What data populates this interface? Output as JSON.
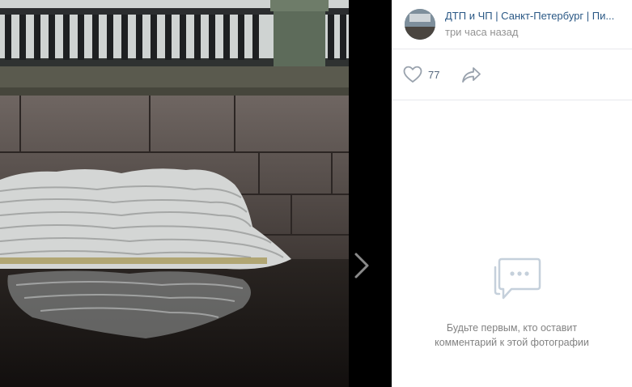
{
  "post": {
    "group_name": "ДТП и ЧП | Санкт-Петербург | Пи...",
    "time": "три часа назад",
    "likes": "77"
  },
  "comments": {
    "empty_line1": "Будьте первым, кто оставит",
    "empty_line2": "комментарий к этой фотографии"
  },
  "icons": {
    "like": "heart-icon",
    "share": "share-arrow-icon",
    "next": "chevron-right-icon",
    "empty": "comment-bubble-icon"
  },
  "colors": {
    "link": "#2a5885",
    "muted": "#939393",
    "icon": "#99a2ad"
  }
}
